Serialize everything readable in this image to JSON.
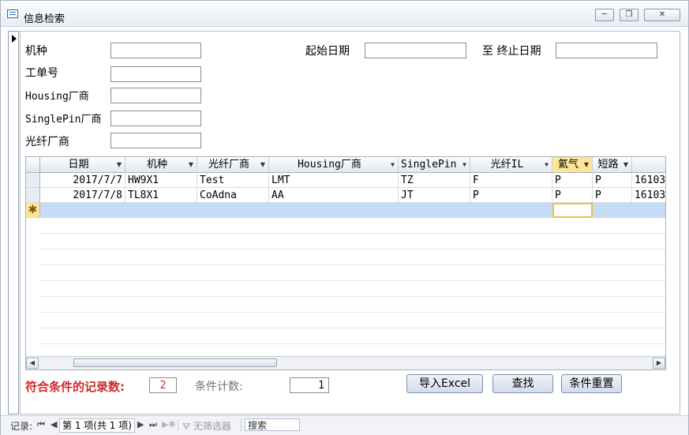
{
  "window": {
    "title": "信息检索"
  },
  "form": {
    "labels": {
      "model": "机种",
      "workorder": "工单号",
      "housing_vendor": "Housing厂商",
      "singlepin_vendor": "SinglePin厂商",
      "fiber_vendor": "光纤厂商",
      "start_date": "起始日期",
      "end_date": "至 终止日期"
    }
  },
  "grid": {
    "columns": [
      "日期",
      "机种",
      "光纤厂商",
      "Housing厂商",
      "SinglePin",
      "光纤IL",
      "氦气",
      "短路",
      ""
    ],
    "rows": [
      [
        "2017/7/7",
        "HW9X1",
        "Test",
        "LMT",
        "TZ",
        "F",
        "P",
        "P",
        "16103"
      ],
      [
        "2017/7/8",
        "TL8X1",
        "CoAdna",
        "AA",
        "JT",
        "P",
        "P",
        "P",
        "16103"
      ]
    ],
    "new_row_marker": "✱"
  },
  "footer": {
    "match_label": "符合条件的记录数:",
    "match_count": "2",
    "cond_label": "条件计数:",
    "cond_count": "1",
    "btn_import": "导入Excel",
    "btn_find": "查找",
    "btn_reset": "条件重置"
  },
  "statusbar": {
    "record_label": "记录:",
    "position": "第 1 项(共 1 项)",
    "filter": "无筛选器",
    "search": "搜索"
  },
  "colors": {
    "accent_red": "#d12a2a",
    "selected_header": "#fde596",
    "new_row": "#c4dcf6"
  }
}
